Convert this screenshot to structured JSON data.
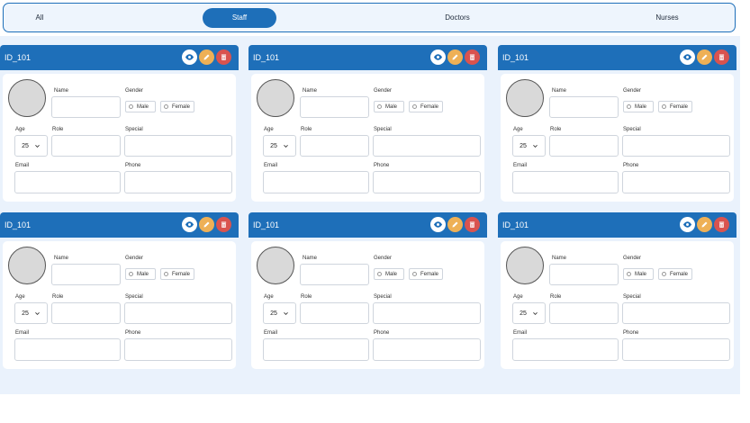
{
  "tabs": [
    {
      "label": "All",
      "active": false
    },
    {
      "label": "Staff",
      "active": true
    },
    {
      "label": "Doctors",
      "active": false
    },
    {
      "label": "Nurses",
      "active": false
    }
  ],
  "cards": [
    {
      "id": "ID_101",
      "name_label": "Name",
      "gender_label": "Gender",
      "male_label": "Male",
      "female_label": "Female",
      "age_label": "Age",
      "age_value": "25",
      "role_label": "Role",
      "special_label": "Special",
      "email_label": "Email",
      "phone_label": "Phone"
    },
    {
      "id": "ID_101",
      "name_label": "Name",
      "gender_label": "Gender",
      "male_label": "Male",
      "female_label": "Female",
      "age_label": "Age",
      "age_value": "25",
      "role_label": "Role",
      "special_label": "Special",
      "email_label": "Email",
      "phone_label": "Phone"
    },
    {
      "id": "ID_101",
      "name_label": "Name",
      "gender_label": "Gender",
      "male_label": "Male",
      "female_label": "Female",
      "age_label": "Age",
      "age_value": "25",
      "role_label": "Role",
      "special_label": "Special",
      "email_label": "Email",
      "phone_label": "Phone"
    },
    {
      "id": "ID_101",
      "name_label": "Name",
      "gender_label": "Gender",
      "male_label": "Male",
      "female_label": "Female",
      "age_label": "Age",
      "age_value": "25",
      "role_label": "Role",
      "special_label": "Special",
      "email_label": "Email",
      "phone_label": "Phone"
    },
    {
      "id": "ID_101",
      "name_label": "Name",
      "gender_label": "Gender",
      "male_label": "Male",
      "female_label": "Female",
      "age_label": "Age",
      "age_value": "25",
      "role_label": "Role",
      "special_label": "Special",
      "email_label": "Email",
      "phone_label": "Phone"
    },
    {
      "id": "ID_101",
      "name_label": "Name",
      "gender_label": "Gender",
      "male_label": "Male",
      "female_label": "Female",
      "age_label": "Age",
      "age_value": "25",
      "role_label": "Role",
      "special_label": "Special",
      "email_label": "Email",
      "phone_label": "Phone"
    }
  ],
  "colors": {
    "primary": "#1e6fb9",
    "view": "#ffffff",
    "edit": "#eeb056",
    "delete": "#d9534f",
    "background": "#eaf2fc"
  },
  "icons": {
    "view": "eye-icon",
    "edit": "pencil-icon",
    "delete": "trash-icon",
    "dropdown": "chevron-down-icon"
  }
}
